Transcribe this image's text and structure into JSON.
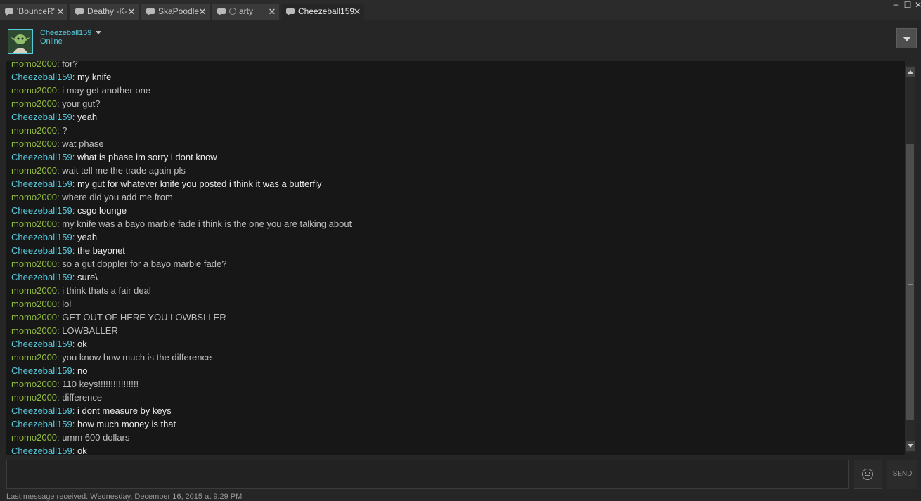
{
  "tabs": [
    {
      "label": "'BounceR'",
      "close": "✕"
    },
    {
      "label": "Deathy -K-",
      "close": "✕"
    },
    {
      "label": "SkaPoodle",
      "close": "✕"
    },
    {
      "label": "arty",
      "close": "✕"
    },
    {
      "label": "Cheezeball159",
      "close": "✕",
      "active": true
    }
  ],
  "window_controls": {
    "minimize": "–",
    "maximize": "☐",
    "close": "✕"
  },
  "header": {
    "username": "Cheezeball159",
    "status": "Online"
  },
  "colors": {
    "self_name": "#57cbde",
    "other_name": "#90ba3c",
    "background": "#262626",
    "chat_bg": "#171717"
  },
  "chat": {
    "messages": [
      {
        "from": "momo2000",
        "self": false,
        "text": "for?"
      },
      {
        "from": "Cheezeball159",
        "self": true,
        "text": "my knife"
      },
      {
        "from": "momo2000",
        "self": false,
        "text": "i may get another one"
      },
      {
        "from": "momo2000",
        "self": false,
        "text": "your gut?"
      },
      {
        "from": "Cheezeball159",
        "self": true,
        "text": "yeah"
      },
      {
        "from": "momo2000",
        "self": false,
        "text": "?"
      },
      {
        "from": "momo2000",
        "self": false,
        "text": "wat phase"
      },
      {
        "from": "Cheezeball159",
        "self": true,
        "text": "what is phase im sorry i dont know"
      },
      {
        "from": "momo2000",
        "self": false,
        "text": "wait tell me the trade again pls"
      },
      {
        "from": "Cheezeball159",
        "self": true,
        "text": "my gut for whatever knife you posted i think it was a butterfly"
      },
      {
        "from": "momo2000",
        "self": false,
        "text": "where did you add me from"
      },
      {
        "from": "Cheezeball159",
        "self": true,
        "text": "csgo lounge"
      },
      {
        "from": "momo2000",
        "self": false,
        "text": "my knife was a bayo marble fade i think is the one you are talking about"
      },
      {
        "from": "Cheezeball159",
        "self": true,
        "text": "yeah"
      },
      {
        "from": "Cheezeball159",
        "self": true,
        "text": "the bayonet"
      },
      {
        "from": "momo2000",
        "self": false,
        "text": "so a gut doppler for a bayo marble fade?"
      },
      {
        "from": "Cheezeball159",
        "self": true,
        "text": "sure\\"
      },
      {
        "from": "momo2000",
        "self": false,
        "text": "i think thats a fair deal"
      },
      {
        "from": "momo2000",
        "self": false,
        "text": "lol"
      },
      {
        "from": "momo2000",
        "self": false,
        "text": "GET OUT OF HERE YOU LOWBSLLER"
      },
      {
        "from": "momo2000",
        "self": false,
        "text": "LOWBALLER"
      },
      {
        "from": "Cheezeball159",
        "self": true,
        "text": "ok"
      },
      {
        "from": "momo2000",
        "self": false,
        "text": "you know how much is the difference"
      },
      {
        "from": "Cheezeball159",
        "self": true,
        "text": "no"
      },
      {
        "from": "momo2000",
        "self": false,
        "text": "110 keys!!!!!!!!!!!!!!!!"
      },
      {
        "from": "momo2000",
        "self": false,
        "text": "difference"
      },
      {
        "from": "Cheezeball159",
        "self": true,
        "text": "i dont measure by keys"
      },
      {
        "from": "Cheezeball159",
        "self": true,
        "text": "how much money is that"
      },
      {
        "from": "momo2000",
        "self": false,
        "text": "umm 600 dollars"
      },
      {
        "from": "Cheezeball159",
        "self": true,
        "text": "ok"
      }
    ]
  },
  "input": {
    "value": "",
    "placeholder": ""
  },
  "send_label": "SEND",
  "footer": {
    "last_message": "Last message received: Wednesday, December 16, 2015 at 9:29 PM"
  }
}
